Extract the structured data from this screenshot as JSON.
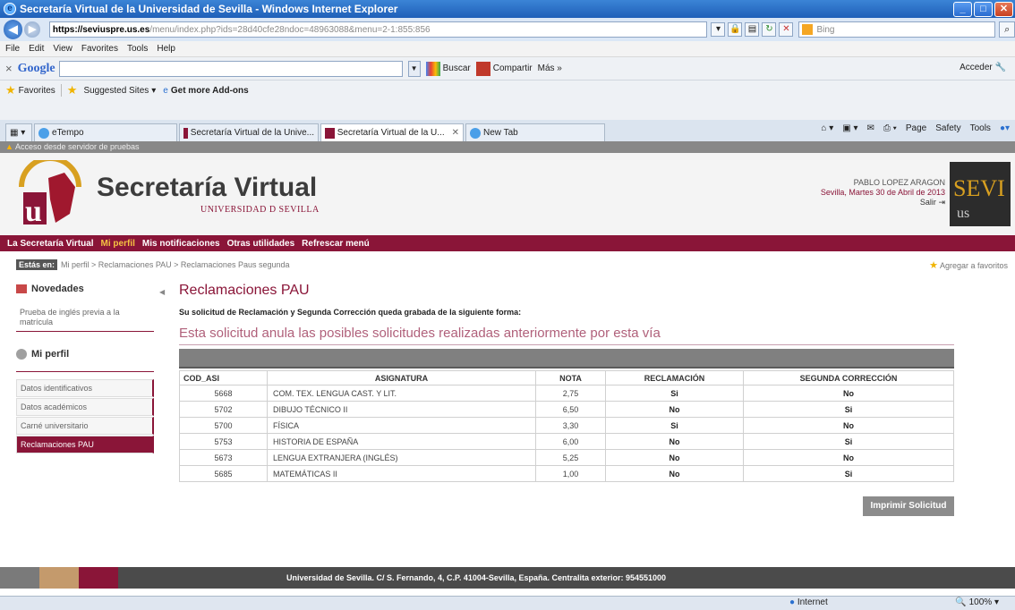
{
  "window": {
    "title": "Secretaría Virtual de la Universidad de Sevilla - Windows Internet Explorer"
  },
  "address": {
    "host": "https://seviuspre.us.es",
    "path": "/menu/index.php?ids=28d40cfe28ndoc=48963088&menu=2-1:855:856",
    "search_placeholder": "Bing"
  },
  "menubar": [
    "File",
    "Edit",
    "View",
    "Favorites",
    "Tools",
    "Help"
  ],
  "google_toolbar": {
    "logo": "Google",
    "buscar": "Buscar",
    "compartir": "Compartir",
    "mas": "Más »",
    "acceder": "Acceder"
  },
  "favorites_bar": {
    "favorites": "Favorites",
    "suggested": "Suggested Sites",
    "addons": "Get more Add-ons"
  },
  "tabs": [
    {
      "label": "eTempo"
    },
    {
      "label": "Secretaría Virtual de la Unive..."
    },
    {
      "label": "Secretaría Virtual de la U..."
    },
    {
      "label": "New Tab"
    }
  ],
  "command_bar": {
    "page": "Page",
    "safety": "Safety",
    "tools": "Tools"
  },
  "site": {
    "warning": "Acceso desde servidor de pruebas",
    "title": "Secretaría Virtual",
    "subtitle": "UNIVERSIDAD D SEVILLA",
    "user_name": "PABLO LOPEZ ARAGON",
    "date": "Sevilla, Martes 30 de Abril de 2013",
    "salir": "Salir",
    "sevi_logo": "SEVI",
    "sevi_sub": "us"
  },
  "nav": [
    {
      "label": "La Secretaría Virtual",
      "highlight": false
    },
    {
      "label": "Mi perfil",
      "highlight": true
    },
    {
      "label": "Mis notificaciones",
      "highlight": false
    },
    {
      "label": "Otras utilidades",
      "highlight": false
    },
    {
      "label": "Refrescar menú",
      "highlight": false
    }
  ],
  "breadcrumb": {
    "tag": "Estás en:",
    "path": "Mi perfil > Reclamaciones PAU > Reclamaciones Paus segunda",
    "add_fav": "Agregar a favoritos"
  },
  "sidebar": {
    "novedades": "Novedades",
    "novedades_link": "Prueba de inglés previa a la matrícula",
    "perfil": "Mi perfil",
    "items": [
      {
        "label": "Datos identificativos",
        "active": false
      },
      {
        "label": "Datos académicos",
        "active": false
      },
      {
        "label": "Carné universitario",
        "active": false
      },
      {
        "label": "Reclamaciones PAU",
        "active": true
      }
    ]
  },
  "main": {
    "title": "Reclamaciones PAU",
    "intro": "Su solicitud de Reclamación y Segunda Corrección queda grabada de la siguiente forma:",
    "notice": "Esta solicitud anula las posibles solicitudes realizadas anteriormente por esta vía",
    "columns": [
      "COD_ASI",
      "ASIGNATURA",
      "NOTA",
      "RECLAMACIÓN",
      "SEGUNDA CORRECCIÓN"
    ],
    "rows": [
      [
        "5668",
        "COM. TEX. LENGUA CAST. Y LIT.",
        "2,75",
        "Si",
        "No"
      ],
      [
        "5702",
        "DIBUJO TÉCNICO II",
        "6,50",
        "No",
        "Si"
      ],
      [
        "5700",
        "FÍSICA",
        "3,30",
        "Si",
        "No"
      ],
      [
        "5753",
        "HISTORIA DE ESPAÑA",
        "6,00",
        "No",
        "Si"
      ],
      [
        "5673",
        "LENGUA EXTRANJERA (INGLÉS)",
        "5,25",
        "No",
        "No"
      ],
      [
        "5685",
        "MATEMÁTICAS II",
        "1,00",
        "No",
        "Si"
      ]
    ],
    "print_button": "Imprimir Solicitud"
  },
  "footer": {
    "text": "Universidad de Sevilla. C/ S. Fernando, 4, C.P. 41004-Sevilla, España. Centralita exterior: 954551000"
  },
  "status": {
    "zone": "Internet",
    "zoom": "100%"
  },
  "colors": {
    "brand": "#8a1538",
    "highlight": "#f5c242",
    "ie_blue": "#1f5fb8"
  }
}
